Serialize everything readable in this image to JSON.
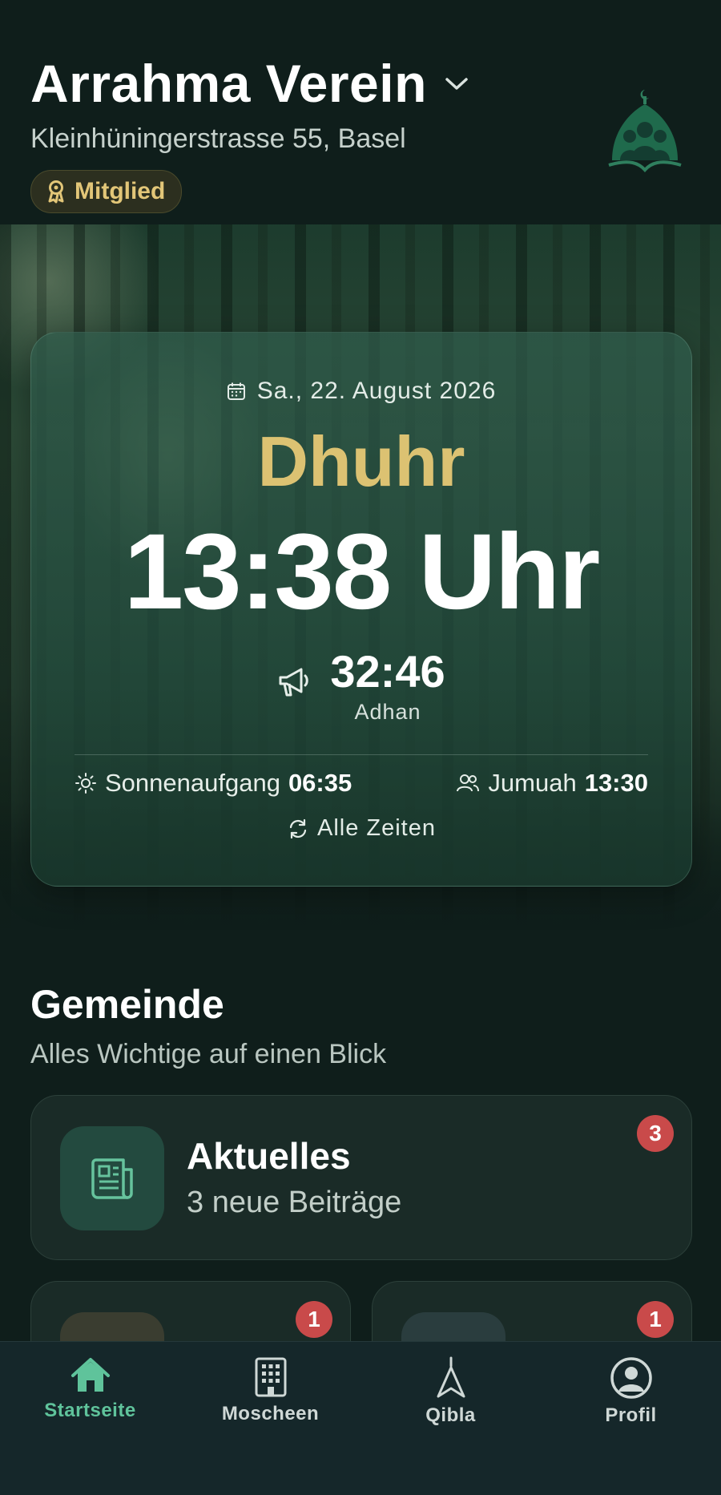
{
  "header": {
    "title": "Arrahma Verein",
    "address": "Kleinhüningerstrasse 55, Basel",
    "badge": "Mitglied"
  },
  "prayer_card": {
    "date": "Sa., 22. August 2026",
    "prayer_name": "Dhuhr",
    "prayer_time": "13:38 Uhr",
    "countdown": "32:46",
    "countdown_label": "Adhan",
    "sunrise_label": "Sonnenaufgang",
    "sunrise_time": "06:35",
    "jumuah_label": "Jumuah",
    "jumuah_time": "13:30",
    "all_times_label": "Alle Zeiten"
  },
  "section": {
    "title": "Gemeinde",
    "subtitle": "Alles Wichtige auf einen Blick"
  },
  "news_card": {
    "title": "Aktuelles",
    "subtitle": "3 neue Beiträge",
    "badge_count": "3"
  },
  "small_cards": [
    {
      "badge_count": "1"
    },
    {
      "badge_count": "1"
    }
  ],
  "tabbar": {
    "tabs": [
      {
        "label": "Startseite",
        "icon": "home-icon",
        "active": true
      },
      {
        "label": "Moscheen",
        "icon": "building-icon",
        "active": false
      },
      {
        "label": "Qibla",
        "icon": "compass-needle-icon",
        "active": false
      },
      {
        "label": "Profil",
        "icon": "user-circle-icon",
        "active": false
      }
    ]
  },
  "colors": {
    "background": "#0f1e1b",
    "accent_gold": "#dcc272",
    "accent_green": "#5fc39b",
    "badge_red": "#c94a4a"
  }
}
